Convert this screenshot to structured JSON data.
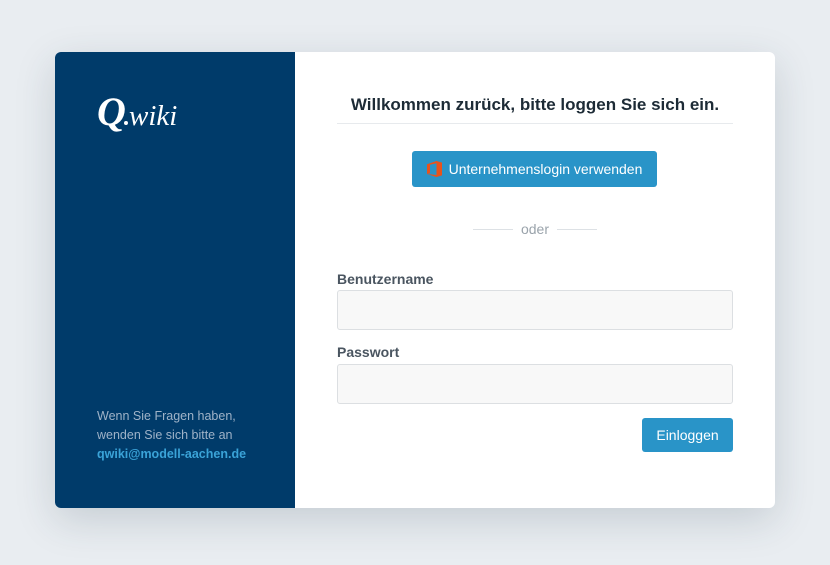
{
  "sidebar": {
    "logo_text": "Q.wiki",
    "help_line1": "Wenn Sie Fragen haben,",
    "help_line2": "wenden Sie sich bitte an",
    "help_email": "qwiki@modell-aachen.de"
  },
  "login": {
    "title": "Willkommen zurück, bitte loggen Sie sich ein.",
    "sso_button": "Unternehmenslogin verwenden",
    "sso_icon": "office-icon",
    "divider_text": "oder",
    "username_label": "Benutzername",
    "username_value": "",
    "password_label": "Passwort",
    "password_value": "",
    "submit_button": "Einloggen"
  },
  "colors": {
    "sidebar_bg": "#003b6a",
    "accent": "#2994c8",
    "office_icon": "#e8531c",
    "email_link": "#3aa3d8"
  }
}
